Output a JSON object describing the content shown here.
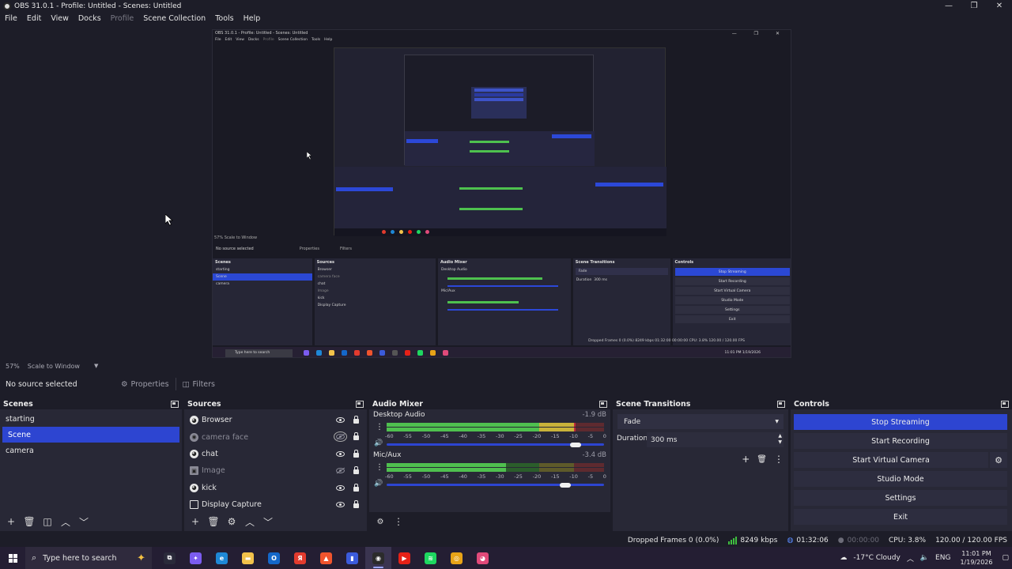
{
  "window": {
    "title": "OBS 31.0.1 - Profile: Untitled - Scenes: Untitled",
    "controls": [
      "—",
      "❐",
      "✕"
    ]
  },
  "menu": [
    {
      "label": "File",
      "enabled": true
    },
    {
      "label": "Edit",
      "enabled": true
    },
    {
      "label": "View",
      "enabled": true
    },
    {
      "label": "Docks",
      "enabled": true
    },
    {
      "label": "Profile",
      "enabled": false
    },
    {
      "label": "Scene Collection",
      "enabled": true
    },
    {
      "label": "Tools",
      "enabled": true
    },
    {
      "label": "Help",
      "enabled": true
    }
  ],
  "preview": {
    "nested_title": "OBS 31.0.1 - Profile: Untitled - Scenes: Untitled",
    "nested_menu": [
      "File",
      "Edit",
      "View",
      "Docks",
      "Profile",
      "Scene Collection",
      "Tools",
      "Help"
    ],
    "nested_status": "57%   Scale to Window",
    "nested_context": "No source selected",
    "nested_properties": "Properties",
    "nested_filters": "Filters",
    "nested_scenes_title": "Scenes",
    "nested_scenes": [
      "starting",
      "Scene",
      "camera"
    ],
    "nested_sources_title": "Sources",
    "nested_sources": [
      "Browser",
      "camera face",
      "chat",
      "Image",
      "kick",
      "Display Capture"
    ],
    "nested_mixer_title": "Audio Mixer",
    "nested_mixer_ch1": "Desktop Audio",
    "nested_mixer_ch2": "Mic/Aux",
    "nested_trans_title": "Scene Transitions",
    "nested_trans_fade": "Fade",
    "nested_trans_duration": "Duration",
    "nested_trans_ms": "300 ms",
    "nested_controls_title": "Controls",
    "nested_controls": [
      "Stop Streaming",
      "Start Recording",
      "Start Virtual Camera",
      "Studio Mode",
      "Settings",
      "Exit"
    ],
    "nested_status_right": "Dropped Frames 0 (0.0%)   8249 kbps   01:32:00   00:00:00   CPU: 3.8%   120.00 / 120.00 FPS",
    "nested_search": "Type here to search",
    "nested_weather": "-17°C Cloudy",
    "nested_clock": "11:01 PM  1/19/2026"
  },
  "scale_bar": {
    "percent": "57%",
    "mode": "Scale to Window"
  },
  "context_bar": {
    "label": "No source selected",
    "properties": "Properties",
    "filters": "Filters"
  },
  "scenes": {
    "title": "Scenes",
    "items": [
      {
        "label": "starting",
        "selected": false
      },
      {
        "label": "Scene",
        "selected": true
      },
      {
        "label": "camera",
        "selected": false
      }
    ]
  },
  "sources": {
    "title": "Sources",
    "items": [
      {
        "label": "Browser",
        "visible": true,
        "type": "browser"
      },
      {
        "label": "camera face",
        "visible": false,
        "type": "camera"
      },
      {
        "label": "chat",
        "visible": true,
        "type": "browser"
      },
      {
        "label": "Image",
        "visible": false,
        "type": "image"
      },
      {
        "label": "kick",
        "visible": true,
        "type": "browser"
      },
      {
        "label": "Display Capture",
        "visible": true,
        "type": "display"
      }
    ]
  },
  "audio_mixer": {
    "title": "Audio Mixer",
    "ticks": [
      "-60",
      "-55",
      "-50",
      "-45",
      "-40",
      "-35",
      "-30",
      "-25",
      "-20",
      "-15",
      "-10",
      "-5",
      "0"
    ],
    "channels": [
      {
        "name": "Desktop Audio",
        "db": "-1.9 dB",
        "level": 0.87,
        "volume": 0.87
      },
      {
        "name": "Mic/Aux",
        "db": "-3.4 dB",
        "level": 0.55,
        "volume": 0.82
      }
    ]
  },
  "transitions": {
    "title": "Scene Transitions",
    "selected": "Fade",
    "duration_label": "Duration",
    "duration_value": "300 ms"
  },
  "controls": {
    "title": "Controls",
    "stop_streaming": "Stop Streaming",
    "start_recording": "Start Recording",
    "start_virtual_camera": "Start Virtual Camera",
    "studio_mode": "Studio Mode",
    "settings": "Settings",
    "exit": "Exit"
  },
  "status": {
    "dropped_frames": "Dropped Frames 0 (0.0%)",
    "bitrate": "8249 kbps",
    "stream_time": "01:32:06",
    "record_time": "00:00:00",
    "cpu": "CPU: 3.8%",
    "fps": "120.00 / 120.00 FPS"
  },
  "taskbar": {
    "search_placeholder": "Type here to search",
    "weather": "-17°C Cloudy",
    "language": "ENG",
    "time": "11:01 PM",
    "date": "1/19/2026",
    "apps": [
      {
        "name": "task-view-icon",
        "color": "#2a2a3a",
        "glyph": "⧉"
      },
      {
        "name": "copilot-icon",
        "color": "#7b5cf0",
        "glyph": "✦"
      },
      {
        "name": "edge-icon",
        "color": "#1e88d6",
        "glyph": "e"
      },
      {
        "name": "file-explorer-icon",
        "color": "#f2c24a",
        "glyph": "▬"
      },
      {
        "name": "outlook-icon",
        "color": "#1467c9",
        "glyph": "O"
      },
      {
        "name": "yandex-icon",
        "color": "#e23b2e",
        "glyph": "Я"
      },
      {
        "name": "brave-icon",
        "color": "#f0542d",
        "glyph": "▲"
      },
      {
        "name": "stats-icon",
        "color": "#3b5bdb",
        "glyph": "▮"
      },
      {
        "name": "obs-icon",
        "color": "#2b2b2b",
        "glyph": "◉"
      },
      {
        "name": "youtube-icon",
        "color": "#e62117",
        "glyph": "▶"
      },
      {
        "name": "spotify-icon",
        "color": "#1ed760",
        "glyph": "≋"
      },
      {
        "name": "chrome-icon",
        "color": "#e8a317",
        "glyph": "◎"
      },
      {
        "name": "discord-icon",
        "color": "#e14a7a",
        "glyph": "◕"
      }
    ]
  }
}
